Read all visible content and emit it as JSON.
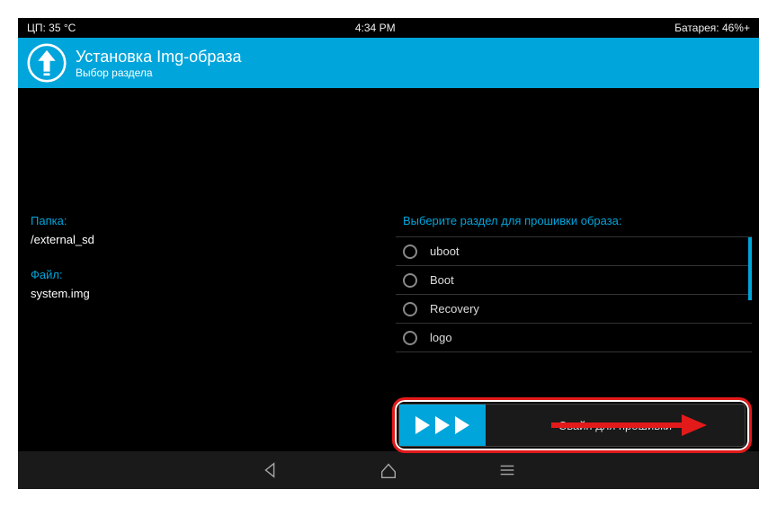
{
  "status": {
    "cpu": "ЦП: 35 °C",
    "time": "4:34 PM",
    "battery": "Батарея: 46%+"
  },
  "header": {
    "title": "Установка Img-образа",
    "subtitle": "Выбор раздела"
  },
  "folder": {
    "label": "Папка:",
    "value": "/external_sd"
  },
  "file": {
    "label": "Файл:",
    "value": "system.img"
  },
  "partition": {
    "label": "Выберите раздел для прошивки образа:",
    "items": [
      "uboot",
      "Boot",
      "Recovery",
      "logo"
    ]
  },
  "swipe": {
    "label": "Свайп для прошивки"
  }
}
